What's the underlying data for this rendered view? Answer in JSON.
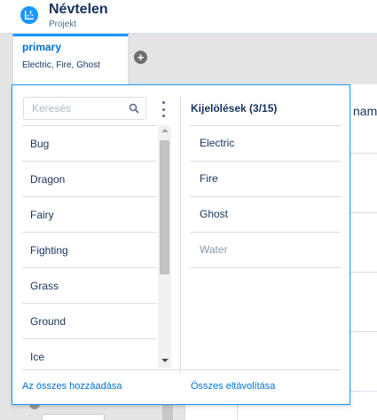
{
  "header": {
    "title": "Névtelen",
    "subtitle": "Projekt",
    "app_icon": "chart-app-icon",
    "accent_color": "#1b96ff"
  },
  "tabs": [
    {
      "name": "primary",
      "items_summary": "Electric, Fire, Ghost"
    }
  ],
  "add_tab_icon": "plus-circle-icon",
  "background": {
    "column_header_partial": "nam"
  },
  "picker": {
    "search": {
      "placeholder": "Keresés",
      "value": ""
    },
    "available_items": [
      "Bug",
      "Dragon",
      "Fairy",
      "Fighting",
      "Grass",
      "Ground",
      "Ice"
    ],
    "selection_title": "Kijelölések (3/15)",
    "selected_items": [
      {
        "label": "Electric",
        "disabled": false
      },
      {
        "label": "Fire",
        "disabled": false
      },
      {
        "label": "Ghost",
        "disabled": false
      },
      {
        "label": "Water",
        "disabled": true
      }
    ],
    "add_all_label": "Az összes hozzáadása",
    "remove_all_label": "Összes eltávolítása"
  }
}
